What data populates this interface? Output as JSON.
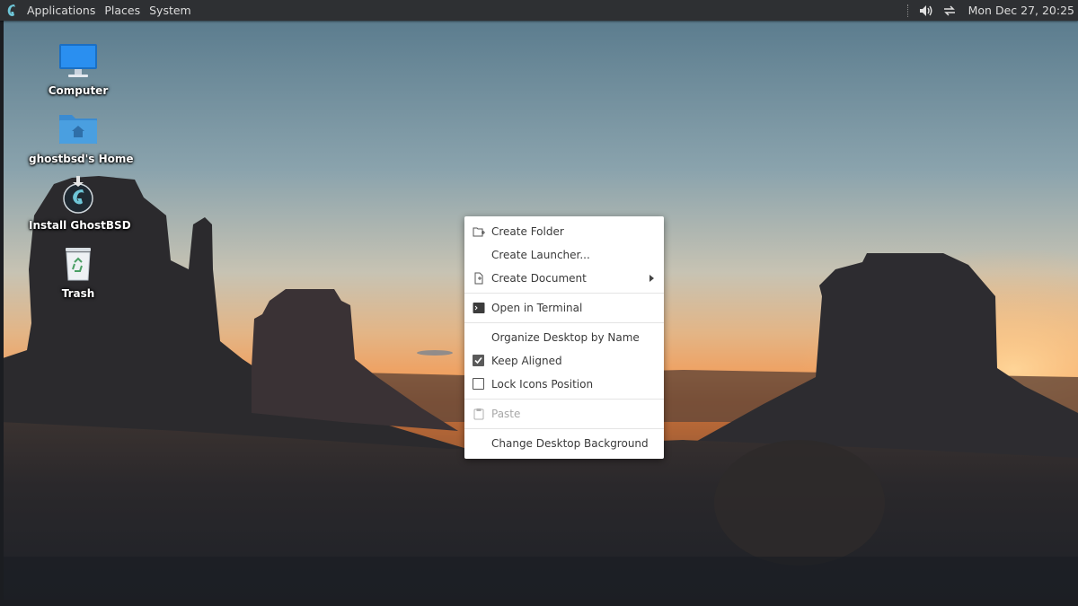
{
  "panel": {
    "menus": [
      "Applications",
      "Places",
      "System"
    ],
    "logo_icon": "ghostbsd-logo-icon",
    "tray_icons": [
      "volume-icon",
      "network-transfer-icon"
    ],
    "clock": "Mon Dec 27, 20:25"
  },
  "desktop": {
    "icons": [
      {
        "label": "Computer",
        "icon": "monitor-icon"
      },
      {
        "label": "ghostbsd's Home",
        "icon": "home-folder-icon"
      },
      {
        "label": "Install GhostBSD",
        "icon": "installer-icon"
      },
      {
        "label": "Trash",
        "icon": "trash-icon"
      }
    ]
  },
  "context_menu": {
    "items": [
      {
        "label": "Create Folder",
        "icon": "new-folder-icon"
      },
      {
        "label": "Create Launcher...",
        "icon": ""
      },
      {
        "label": "Create Document",
        "icon": "new-document-icon",
        "submenu": true
      },
      {
        "label": "Open in Terminal",
        "icon": "terminal-icon"
      },
      {
        "label": "Organize Desktop by Name",
        "icon": ""
      },
      {
        "label": "Keep Aligned",
        "checked": true
      },
      {
        "label": "Lock Icons Position",
        "checked": false
      },
      {
        "label": "Paste",
        "icon": "paste-icon",
        "disabled": true
      },
      {
        "label": "Change Desktop Background",
        "icon": ""
      }
    ]
  },
  "colors": {
    "panel_bg": "#2e3033",
    "menu_bg": "#ffffff",
    "sky_top": "#5b7a8c",
    "sky_horizon": "#e9a66a",
    "folder_blue": "#4a9fe0"
  }
}
